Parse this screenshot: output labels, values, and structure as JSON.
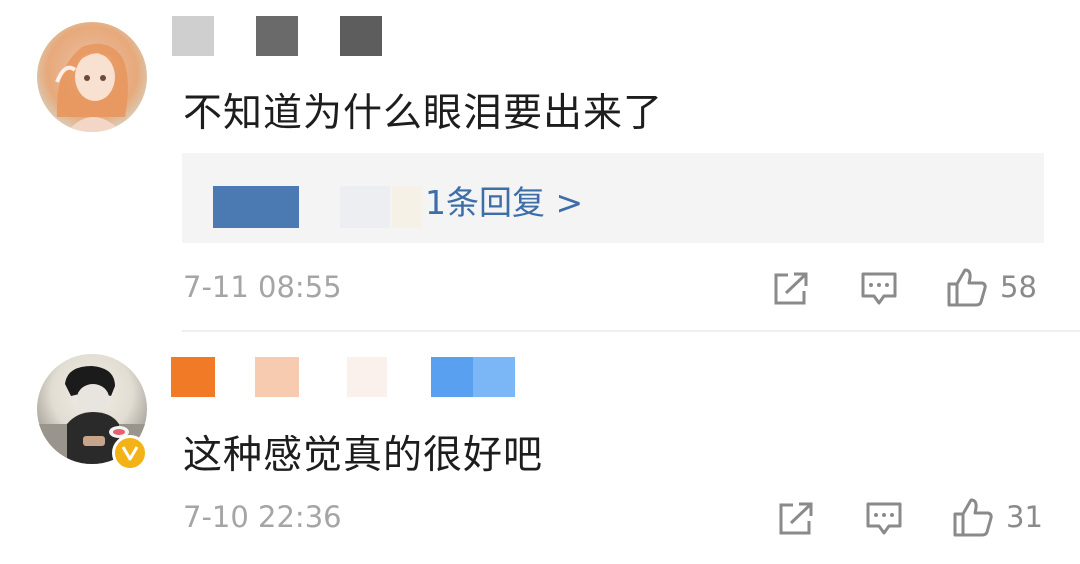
{
  "comments": [
    {
      "text": "不知道为什么眼泪要出来了",
      "reply_link": "1条回复 >",
      "time": "7-11 08:55",
      "like_count": "58",
      "name_colors": [
        "#cfcfcf",
        "#6a6a6a",
        "#5d5d5d"
      ],
      "reply_blur_colors": [
        "#4b7ab3",
        "#eceef1",
        "#f6f1e7"
      ]
    },
    {
      "text": "这种感觉真的很好吧",
      "time": "7-10 22:36",
      "like_count": "31",
      "verified": true,
      "name_colors": [
        "#f07a26",
        "#f7cbb0",
        "#fbe9e0",
        "#5aa0f0",
        "#7bb7f6"
      ]
    }
  ],
  "icons": [
    "share-icon",
    "comment-icon",
    "like-icon",
    "verified-badge-icon"
  ],
  "colors": {
    "text": "#1d1d1d",
    "link": "#3d6ea8",
    "meta": "#a5a5a5",
    "reply_bg": "#f4f4f5",
    "verified": "#f3b316"
  }
}
